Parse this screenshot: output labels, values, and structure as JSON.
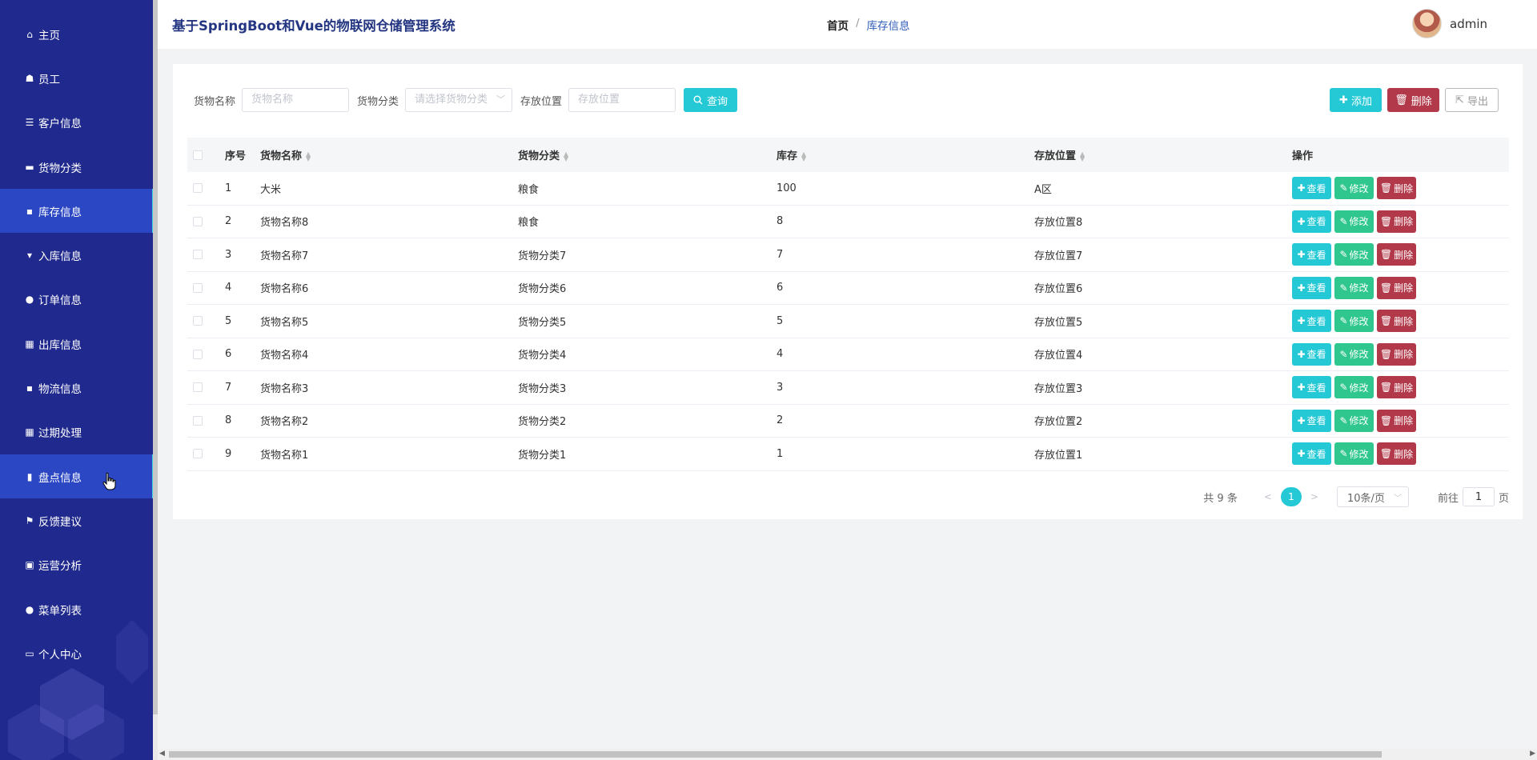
{
  "app": {
    "title": "基于SpringBoot和Vue的物联网仓储管理系统"
  },
  "breadcrumb": {
    "home": "首页",
    "separator": "/",
    "current": "库存信息"
  },
  "user": {
    "name": "admin"
  },
  "sidebar": {
    "items": [
      {
        "label": "主页",
        "icon": "home-icon",
        "glyph": "⌂"
      },
      {
        "label": "员工",
        "icon": "worker-icon",
        "glyph": "☗"
      },
      {
        "label": "客户信息",
        "icon": "sliders-icon",
        "glyph": "☰"
      },
      {
        "label": "货物分类",
        "icon": "ticket-icon",
        "glyph": "▬"
      },
      {
        "label": "库存信息",
        "icon": "chat-icon",
        "glyph": "▪",
        "active": true
      },
      {
        "label": "入库信息",
        "icon": "stamp-icon",
        "glyph": "▾"
      },
      {
        "label": "订单信息",
        "icon": "user-icon",
        "glyph": "●"
      },
      {
        "label": "出库信息",
        "icon": "grid-icon",
        "glyph": "▦"
      },
      {
        "label": "物流信息",
        "icon": "cart-icon",
        "glyph": "▪"
      },
      {
        "label": "过期处理",
        "icon": "grid-icon",
        "glyph": "▦"
      },
      {
        "label": "盘点信息",
        "icon": "bar-chart-icon",
        "glyph": "▮"
      },
      {
        "label": "反馈建议",
        "icon": "flag-icon",
        "glyph": "⚑"
      },
      {
        "label": "运营分析",
        "icon": "clipboard-icon",
        "glyph": "▣"
      },
      {
        "label": "菜单列表",
        "icon": "bulb-icon",
        "glyph": "●"
      },
      {
        "label": "个人中心",
        "icon": "card-icon",
        "glyph": "▭"
      }
    ],
    "active_index": 4,
    "hover_index": 10
  },
  "search": {
    "name_label": "货物名称",
    "name_placeholder": "货物名称",
    "category_label": "货物分类",
    "category_placeholder": "请选择货物分类",
    "location_label": "存放位置",
    "location_placeholder": "存放位置",
    "query_label": "查询"
  },
  "toolbar": {
    "add_label": "添加",
    "delete_label": "删除",
    "export_label": "导出"
  },
  "table": {
    "headers": {
      "index": "序号",
      "name": "货物名称",
      "category": "货物分类",
      "stock": "库存",
      "location": "存放位置",
      "ops": "操作"
    },
    "rows": [
      {
        "idx": "1",
        "name": "大米",
        "category": "粮食",
        "stock": "100",
        "location": "A区"
      },
      {
        "idx": "2",
        "name": "货物名称8",
        "category": "粮食",
        "stock": "8",
        "location": "存放位置8"
      },
      {
        "idx": "3",
        "name": "货物名称7",
        "category": "货物分类7",
        "stock": "7",
        "location": "存放位置7"
      },
      {
        "idx": "4",
        "name": "货物名称6",
        "category": "货物分类6",
        "stock": "6",
        "location": "存放位置6"
      },
      {
        "idx": "5",
        "name": "货物名称5",
        "category": "货物分类5",
        "stock": "5",
        "location": "存放位置5"
      },
      {
        "idx": "6",
        "name": "货物名称4",
        "category": "货物分类4",
        "stock": "4",
        "location": "存放位置4"
      },
      {
        "idx": "7",
        "name": "货物名称3",
        "category": "货物分类3",
        "stock": "3",
        "location": "存放位置3"
      },
      {
        "idx": "8",
        "name": "货物名称2",
        "category": "货物分类2",
        "stock": "2",
        "location": "存放位置2"
      },
      {
        "idx": "9",
        "name": "货物名称1",
        "category": "货物分类1",
        "stock": "1",
        "location": "存放位置1"
      }
    ],
    "ops": {
      "view": "查看",
      "edit": "修改",
      "delete": "删除"
    }
  },
  "pagination": {
    "total_text": "共 9 条",
    "prev": "<",
    "next": ">",
    "current_page": "1",
    "page_size": "10条/页",
    "goto_prefix": "前往",
    "goto_value": "1",
    "goto_suffix": "页"
  },
  "colors": {
    "sidebar": "#202a8e",
    "active": "#2b47c4",
    "accent": "#25c9d6",
    "danger": "#b2394a",
    "success": "#2fc78e",
    "title": "#243682"
  }
}
